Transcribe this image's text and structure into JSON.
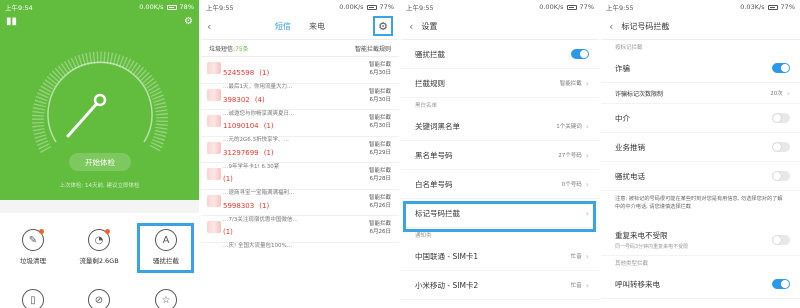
{
  "panel1": {
    "status": {
      "time": "上午9:54",
      "right": "0.00K/s",
      "battery": "78%"
    },
    "check_button": "开始体检",
    "last_check": "上次体检: 14天前, 建议立即体检",
    "tiles": [
      {
        "label": "垃圾清理",
        "icon": "broom-icon",
        "dot": true
      },
      {
        "label": "流量剩2.6GB",
        "icon": "water-drop-icon",
        "dot": true
      },
      {
        "label": "骚扰拦截",
        "icon": "shield-icon",
        "dot": false
      }
    ]
  },
  "panel2": {
    "status": {
      "time": "上午9:55",
      "right": "0.00K/s",
      "battery": "77%"
    },
    "tabs": [
      "短信",
      "来电"
    ],
    "spam_label": "垃圾短信:",
    "spam_count": "75条",
    "smart_rules": "智能拦截规则",
    "messages": [
      {
        "num": "5245598",
        "count": "(1)",
        "preview": "…最后1天，你用流量大力…",
        "tag": "智能拦截",
        "date": "6月30日"
      },
      {
        "num": "398302",
        "count": "(4)",
        "preview": "…诚邀您与你畅享满爽夏日…",
        "tag": "智能拦截",
        "date": "6月30日"
      },
      {
        "num": "11090104",
        "count": "(1)",
        "preview": "…元的2G6.3折快享学、…",
        "tag": "智能拦截",
        "date": "6月30日"
      },
      {
        "num": "31297699",
        "count": "(1)",
        "preview": "…9年学年卡1! 6.30紧",
        "tag": "智能拦截",
        "date": "6月29日"
      },
      {
        "num": "",
        "count": "(1)",
        "preview": "…退商寻宝一宝箱满满福利…",
        "tag": "智能拦截",
        "date": "6月28日"
      },
      {
        "num": "5998303",
        "count": "(1)",
        "preview": "…7/3关注现宿优惠中国微信…",
        "tag": "智能拦截",
        "date": "6月26日"
      },
      {
        "num": "",
        "count": "(1)",
        "preview": "…庆! 全国大流量包100%…",
        "tag": "智能拦截",
        "date": "6月26日"
      }
    ]
  },
  "panel3": {
    "status": {
      "time": "上午9:55",
      "right": "0.00K/s",
      "battery": "77%"
    },
    "title": "设置",
    "rows": [
      {
        "label": "骚扰拦截",
        "type": "toggle",
        "on": true
      },
      {
        "label": "拦截规则",
        "value": "智能拦截",
        "type": "nav"
      }
    ],
    "sec1": "黑白名单",
    "rows2": [
      {
        "label": "关键词黑名单",
        "value": "1个关键词"
      },
      {
        "label": "黑名单号码",
        "value": "27个号码"
      },
      {
        "label": "白名单号码",
        "value": "0个号码"
      },
      {
        "label": "标记号码拦截",
        "value": ""
      }
    ],
    "sec2": "通知类",
    "rows3": [
      {
        "label": "中国联通 - SIM卡1",
        "value": "忙音"
      },
      {
        "label": "小米移动 - SIM卡2",
        "value": "忙音"
      }
    ]
  },
  "panel4": {
    "status": {
      "time": "上午9:55",
      "right": "0.03K/s",
      "battery": "77%"
    },
    "title": "标记号码拦截",
    "sec1": "按标记拦截",
    "fraud": "诈骗",
    "threshold_label": "诈骗标记次数限制",
    "threshold_value": "20次",
    "intermediary": "中介",
    "sales": "业务推销",
    "harass": "骚扰电话",
    "note": "注意: 被标记的号码很可能在某些时刻对您是有用信息, 勿选择您对的了解中的中介电话, 请您谨慎选择拦截",
    "repeat": "重复来电不受限",
    "repeat_sub": "同一号码3分钟内重复来电不受限",
    "sec2": "其他类型拦截",
    "call_transfer": "呼叫转移来电"
  },
  "colors": {
    "green": "#62bc3e",
    "accent": "#2a9ae8",
    "highlight": "#3ba3e3",
    "spam_red": "#e53a2e"
  }
}
